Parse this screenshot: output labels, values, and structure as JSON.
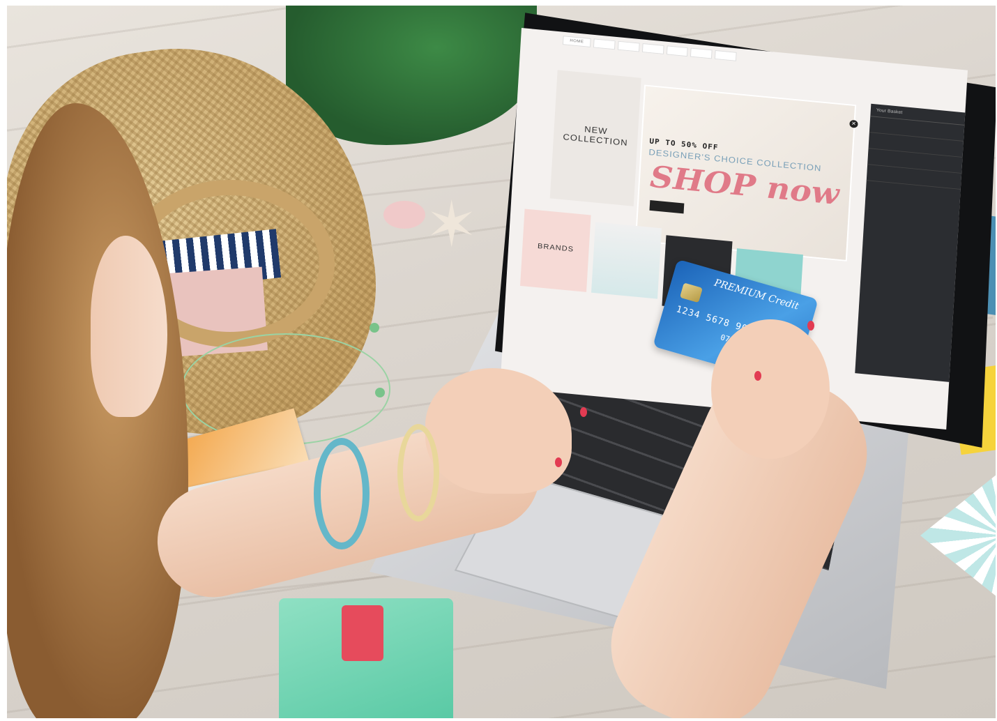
{
  "website": {
    "nav_items": [
      "HOME",
      "",
      "",
      "",
      "",
      "",
      ""
    ],
    "tiles": {
      "new_collection": "NEW\nCOLLECTION",
      "brands": "BRANDS"
    },
    "promo": {
      "line1": "UP TO 50% OFF",
      "line2": "DESIGNER'S CHOICE COLLECTION",
      "headline": "SHOP now"
    },
    "basket": {
      "title": "Your Basket"
    }
  },
  "credit_card": {
    "title": "PREMIUM Credit",
    "number": "1234 5678 9012 3",
    "expiry": "07/20"
  },
  "colors": {
    "screen_bg": "#f4f1ef",
    "tile_pink": "#f6dad6",
    "headline_pink": "#e07a88",
    "basket_dark": "#2b2d31",
    "card_blue": "#1b63b8",
    "wallet_mint": "#58c9a4"
  }
}
